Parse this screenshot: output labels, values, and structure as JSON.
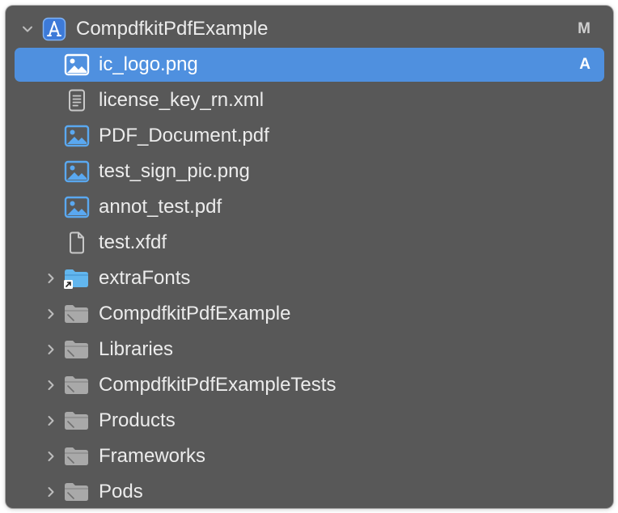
{
  "navigator": {
    "project": {
      "label": "CompdfkitPdfExample",
      "badge": "M",
      "icon": "xcode-project-icon",
      "expanded": true
    },
    "items": [
      {
        "label": "ic_logo.png",
        "icon": "image-file-icon",
        "badge": "A",
        "selected": true
      },
      {
        "label": "license_key_rn.xml",
        "icon": "text-file-icon",
        "badge": ""
      },
      {
        "label": "PDF_Document.pdf",
        "icon": "image-file-icon",
        "badge": ""
      },
      {
        "label": "test_sign_pic.png",
        "icon": "image-file-icon",
        "badge": ""
      },
      {
        "label": "annot_test.pdf",
        "icon": "image-file-icon",
        "badge": ""
      },
      {
        "label": "test.xfdf",
        "icon": "document-icon",
        "badge": ""
      }
    ],
    "groups": [
      {
        "label": "extraFonts",
        "icon": "folder-reference-icon",
        "expanded": false
      },
      {
        "label": "CompdfkitPdfExample",
        "icon": "group-folder-icon",
        "expanded": false
      },
      {
        "label": "Libraries",
        "icon": "group-folder-icon",
        "expanded": false
      },
      {
        "label": "CompdfkitPdfExampleTests",
        "icon": "group-folder-icon",
        "expanded": false
      },
      {
        "label": "Products",
        "icon": "group-folder-icon",
        "expanded": false
      },
      {
        "label": "Frameworks",
        "icon": "group-folder-icon",
        "expanded": false
      },
      {
        "label": "Pods",
        "icon": "group-folder-icon",
        "expanded": false
      }
    ]
  },
  "colors": {
    "background": "#585858",
    "selection": "#4f90df",
    "image_icon": "#5aa8f0",
    "folder_ref": "#62b6ee",
    "group_folder": "#a9a9a9"
  }
}
